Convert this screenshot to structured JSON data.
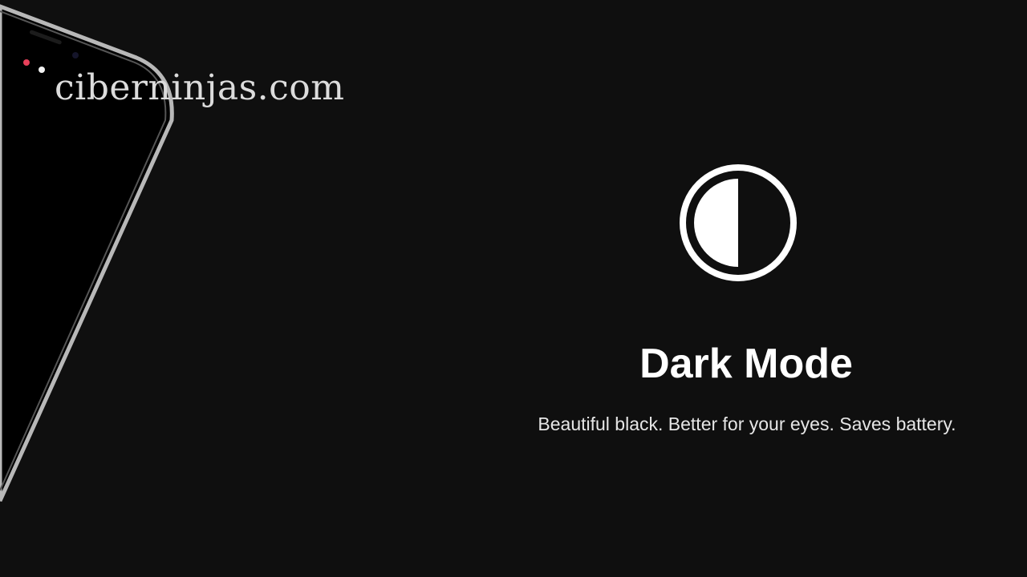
{
  "watermark": {
    "text": "ciberninjas.com"
  },
  "feature": {
    "icon": "half-circle-contrast-icon",
    "title": "Dark Mode",
    "tagline": "Beautiful black. Better for your eyes. Saves battery."
  },
  "colors": {
    "background": "#0f0f0f",
    "text": "#ffffff",
    "notification_dot": "#e8405a"
  }
}
